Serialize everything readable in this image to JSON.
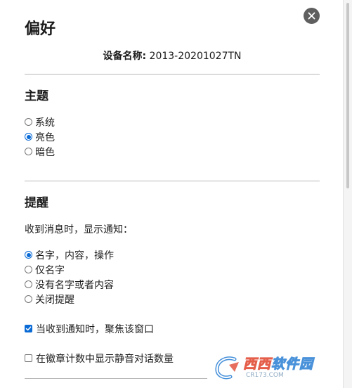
{
  "dialog": {
    "title": "偏好",
    "device_label": "设备名称:",
    "device_name": "2013-20201027TN"
  },
  "theme": {
    "heading": "主题",
    "options": [
      {
        "label": "系统",
        "checked": false
      },
      {
        "label": "亮色",
        "checked": true
      },
      {
        "label": "暗色",
        "checked": false
      }
    ]
  },
  "notifications": {
    "heading": "提醒",
    "description": "收到消息时，显示通知：",
    "options": [
      {
        "label": "名字，内容，操作",
        "checked": true
      },
      {
        "label": "仅名字",
        "checked": false
      },
      {
        "label": "没有名字或者内容",
        "checked": false
      },
      {
        "label": "关闭提醒",
        "checked": false
      }
    ],
    "focus_window": {
      "label": "当收到通知时，聚焦该窗口",
      "checked": true
    },
    "badge_muted": {
      "label": "在徽章计数中显示静音对话数量",
      "checked": false
    }
  },
  "watermark": {
    "brand_a": "西西",
    "brand_b": "软件园",
    "url": "CR173.COM"
  },
  "colors": {
    "accent": "#0a6bd6",
    "close_button": "#5f5f5f",
    "divider": "#b8b8b8"
  }
}
